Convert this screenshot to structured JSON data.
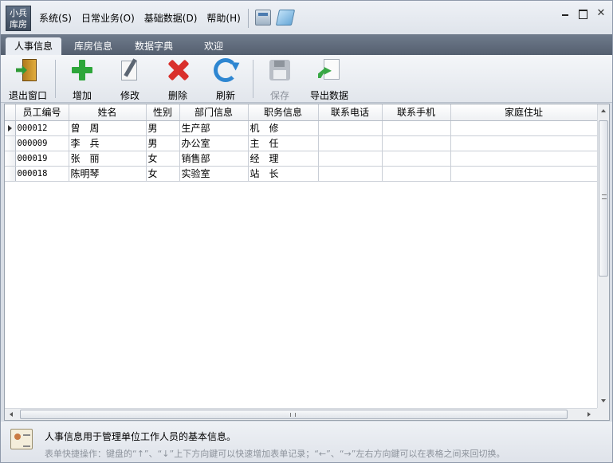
{
  "app": {
    "logo_line1": "小兵",
    "logo_line2": "库房"
  },
  "menu": [
    "系统(S)",
    "日常业务(O)",
    "基础数据(D)",
    "帮助(H)"
  ],
  "tabs": [
    "人事信息",
    "库房信息",
    "数据字典",
    "欢迎"
  ],
  "active_tab": "人事信息",
  "toolbar": {
    "exit": "退出窗口",
    "add": "增加",
    "edit": "修改",
    "delete": "删除",
    "refresh": "刷新",
    "save": "保存",
    "export": "导出数据"
  },
  "table": {
    "columns": [
      "员工编号",
      "姓名",
      "性别",
      "部门信息",
      "职务信息",
      "联系电话",
      "联系手机",
      "家庭住址"
    ],
    "rows": [
      [
        "000012",
        "曾　周",
        "男",
        "生产部",
        "机　修",
        "",
        "",
        ""
      ],
      [
        "000009",
        "李　兵",
        "男",
        "办公室",
        "主　任",
        "",
        "",
        ""
      ],
      [
        "000019",
        "张　丽",
        "女",
        "销售部",
        "经　理",
        "",
        "",
        ""
      ],
      [
        "000018",
        "陈明琴",
        "女",
        "实验室",
        "站　长",
        "",
        "",
        ""
      ]
    ]
  },
  "status": {
    "main": "人事信息用于管理单位工作人员的基本信息。",
    "tip": "表单快捷操作：键盘的“↑”、“↓”上下方向鍵可以快速增加表单记录；“←”、“→”左右方向鍵可以在表格之间来回切换。"
  },
  "colors": {
    "tabbar": "#5f6b7b",
    "grid_bg": "#ffffff",
    "add": "#2ea63a",
    "delete": "#d9302c",
    "refresh": "#2e86d1"
  }
}
